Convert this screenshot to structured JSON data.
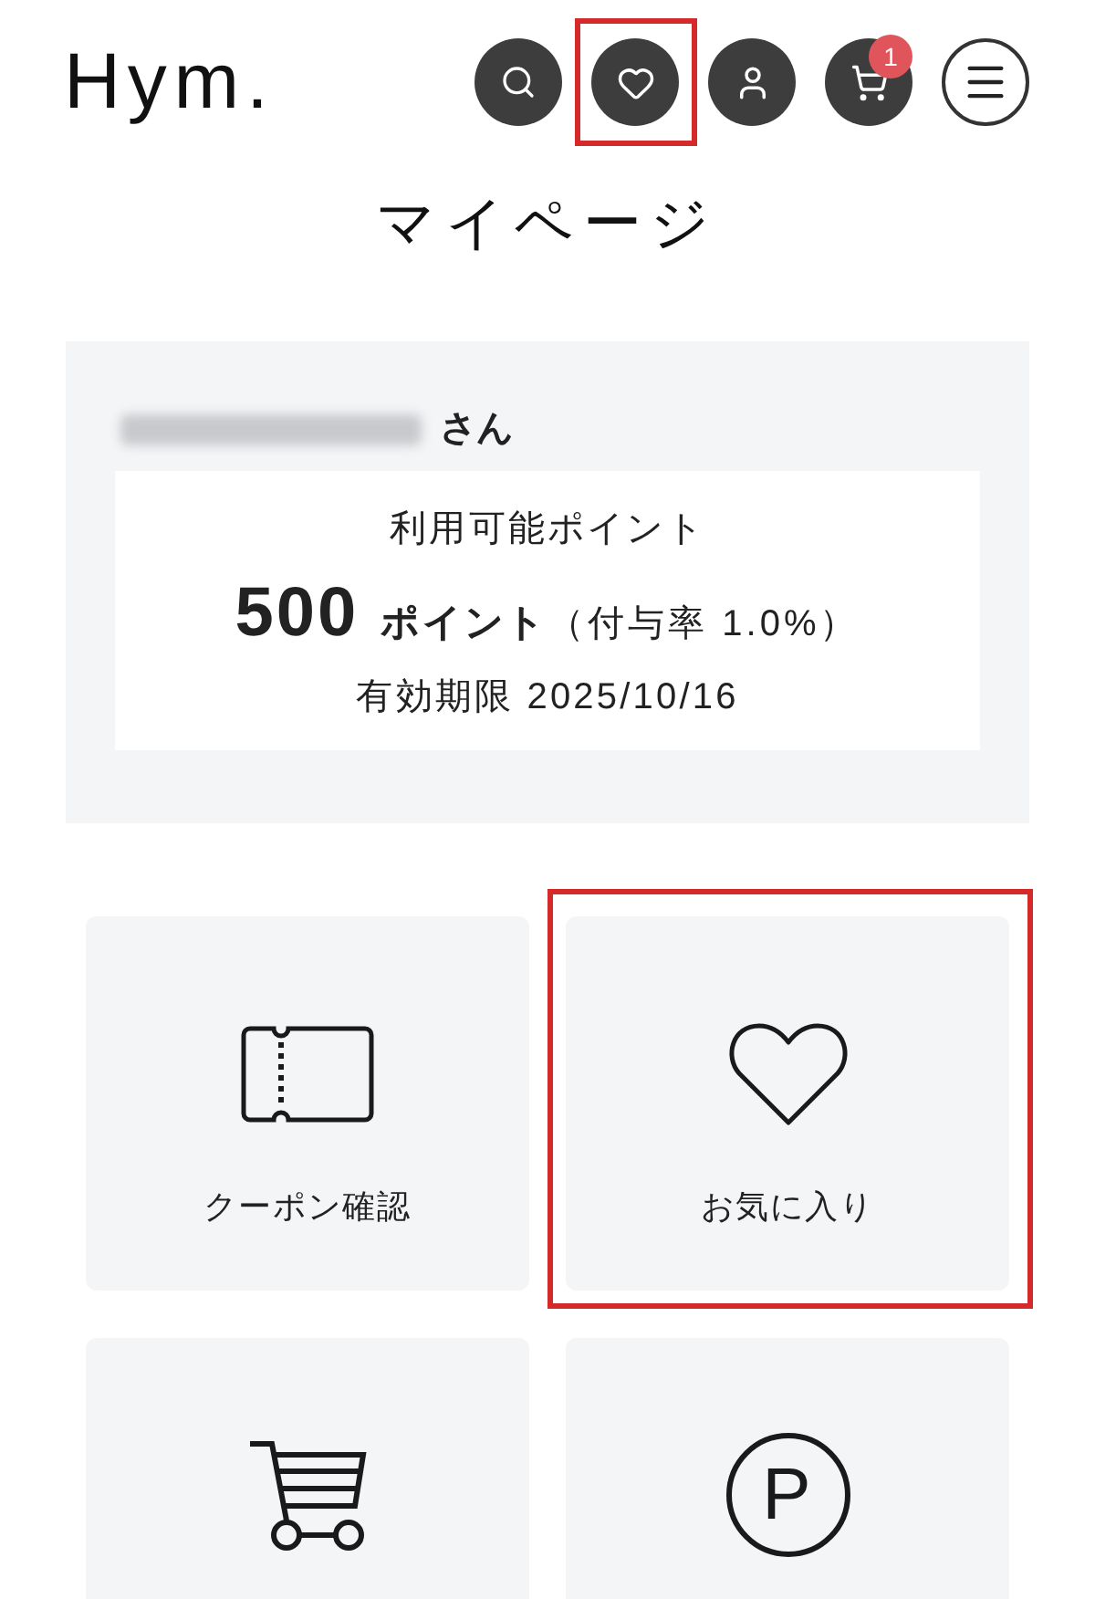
{
  "header": {
    "logo": "Hym.",
    "buttons": [
      {
        "kind": "search",
        "highlighted": false
      },
      {
        "kind": "favorites",
        "highlighted": true
      },
      {
        "kind": "account",
        "highlighted": false
      },
      {
        "kind": "cart",
        "highlighted": false,
        "badge": "1"
      },
      {
        "kind": "menu",
        "highlighted": false
      }
    ]
  },
  "page_title": "マイページ",
  "member_card": {
    "honorific": "さん",
    "points_label": "利用可能ポイント",
    "points_value": "500",
    "points_unit": "ポイント",
    "grant_rate": "（付与率 1.0%）",
    "expiry": "有効期限 2025/10/16"
  },
  "tiles": [
    {
      "kind": "coupon",
      "label": "クーポン確認",
      "highlighted": false
    },
    {
      "kind": "favorites",
      "label": "お気に入り",
      "highlighted": true
    },
    {
      "kind": "cart",
      "highlighted": false
    },
    {
      "kind": "points",
      "symbol": "P",
      "highlighted": false
    }
  ]
}
